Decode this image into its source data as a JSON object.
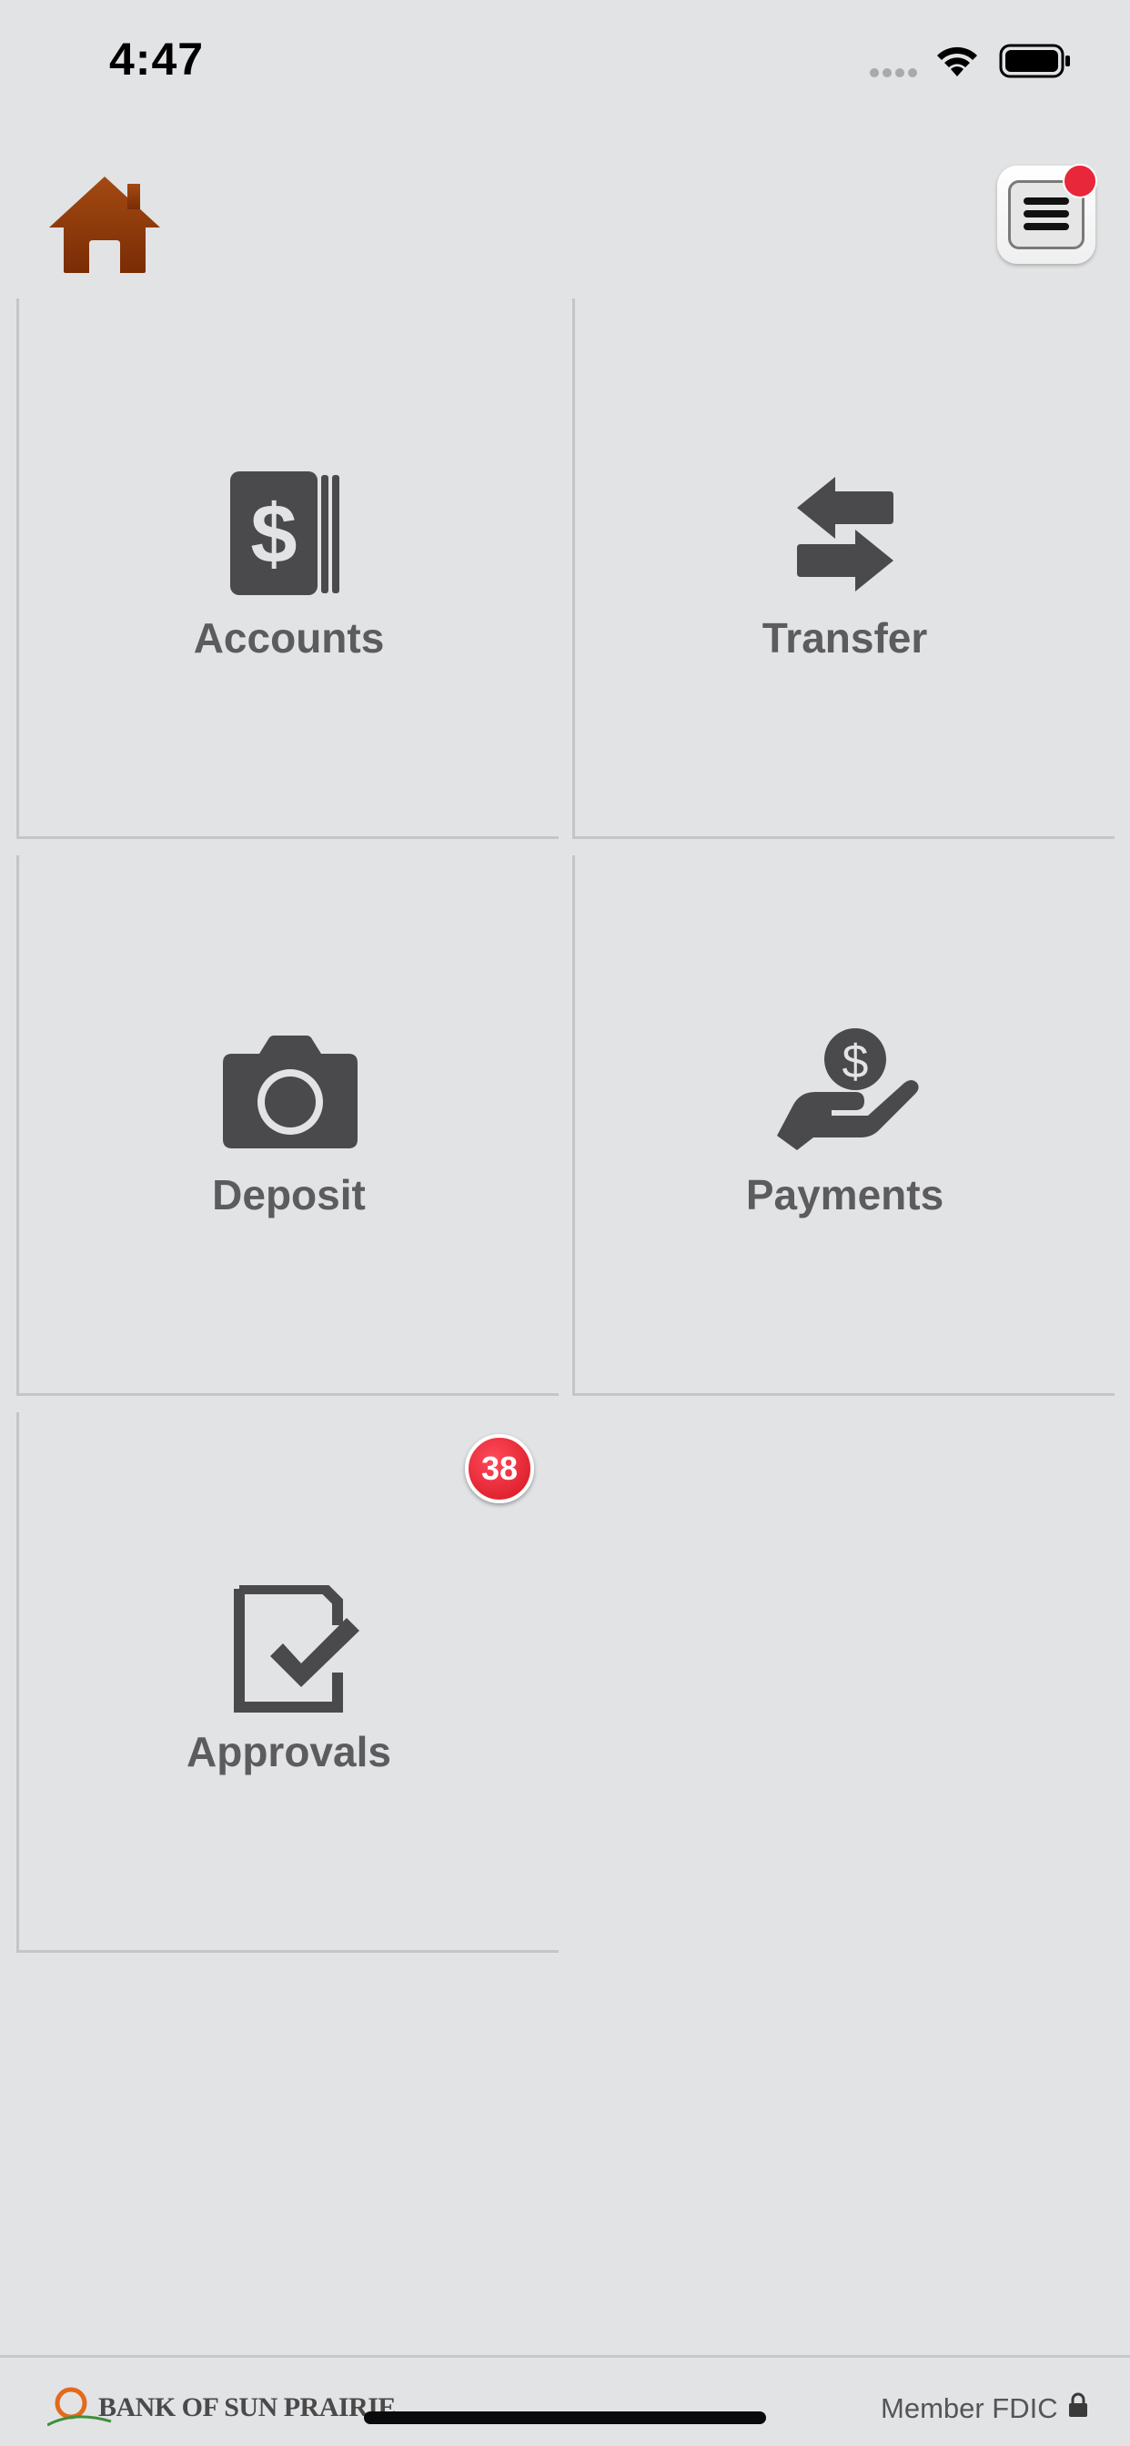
{
  "status_bar": {
    "time": "4:47",
    "icons": [
      "signal-dots-icon",
      "wifi-icon",
      "battery-icon"
    ]
  },
  "header": {
    "home_icon": "home-icon",
    "menu_icon": "hamburger-menu-icon",
    "menu_notification": true,
    "accent_color": "#8a3a0c",
    "notification_color": "#e8273a"
  },
  "tiles": [
    {
      "label": "Accounts",
      "icon": "dollar-bills-icon"
    },
    {
      "label": "Transfer",
      "icon": "transfer-arrows-icon"
    },
    {
      "label": "Deposit",
      "icon": "camera-icon"
    },
    {
      "label": "Payments",
      "icon": "hand-dollar-icon"
    },
    {
      "label": "Approvals",
      "icon": "checklist-icon",
      "badge": "38"
    }
  ],
  "footer": {
    "bank_name": "BANK OF SUN PRAIRIE",
    "member_text": "Member FDIC",
    "icon": "lock-icon"
  }
}
